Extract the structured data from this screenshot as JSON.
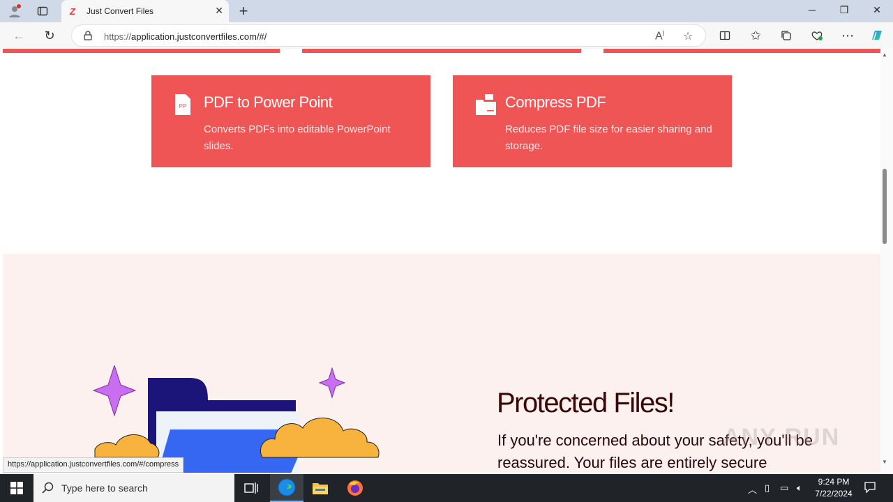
{
  "browser": {
    "tab_title": "Just Convert Files",
    "tab_favicon": "Z",
    "url_proto": "https://",
    "url_rest": "application.justconvertfiles.com/#/",
    "status_url": "https://application.justconvertfiles.com/#/compress"
  },
  "cards": [
    {
      "title": "PDF to Power Point",
      "desc": "Converts PDFs into editable PowerPoint slides.",
      "icon": "pp-file-icon",
      "icon_label": "PP"
    },
    {
      "title": "Compress PDF",
      "desc": "Reduces PDF file size for easier sharing and storage.",
      "icon": "compress-file-icon"
    }
  ],
  "protected": {
    "title": "Protected Files!",
    "text": "If you're concerned about your safety, you'll be reassured. Your files are entirely secure"
  },
  "watermark": "ANY RUN",
  "taskbar": {
    "search_placeholder": "Type here to search",
    "time": "9:24 PM",
    "date": "7/22/2024"
  },
  "colors": {
    "accent": "#f05556",
    "pink_bg": "#fdf1f0",
    "title": "#3a0707"
  }
}
